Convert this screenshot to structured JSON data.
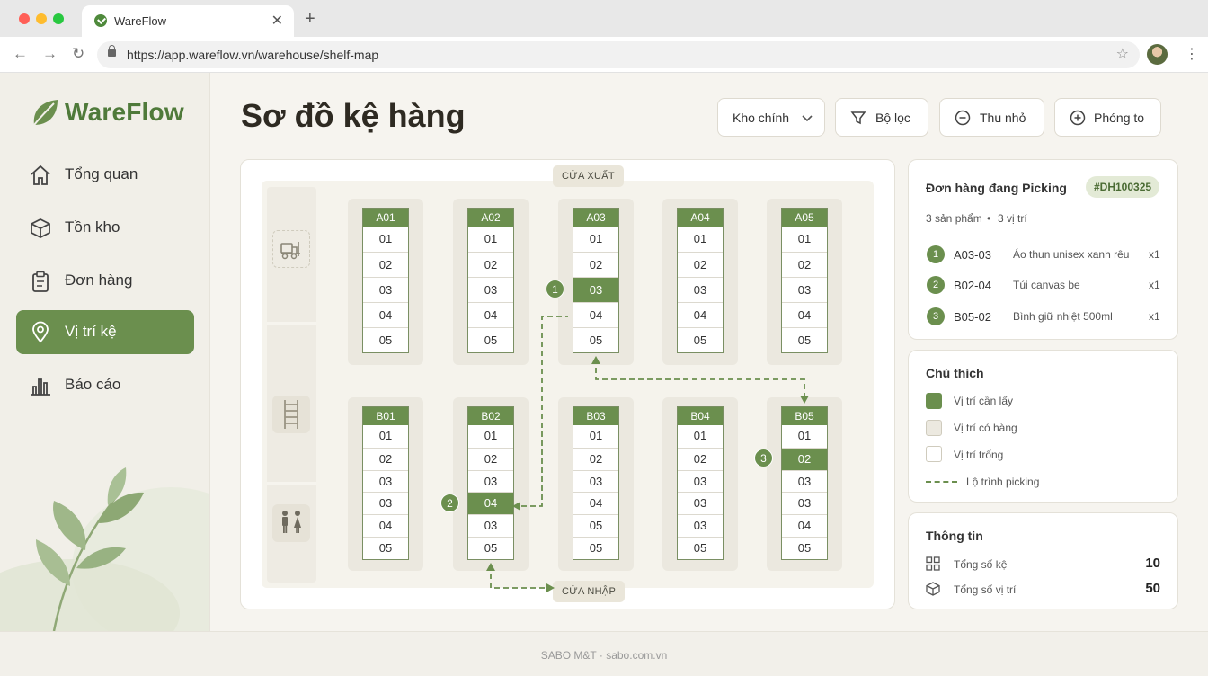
{
  "browser": {
    "tab_title": "WareFlow",
    "url": "https://app.wareflow.vn/warehouse/shelf-map",
    "dot_colors": [
      "#ff5f57",
      "#febc2e",
      "#28c840"
    ]
  },
  "brand": {
    "name": "WareFlow",
    "accent": "#6b8f4e"
  },
  "sidebar": {
    "items": [
      {
        "label": "Tổng quan",
        "icon": "home-icon",
        "active": false
      },
      {
        "label": "Tồn kho",
        "icon": "box-icon",
        "active": false
      },
      {
        "label": "Đơn hàng",
        "icon": "clipboard-icon",
        "active": false
      },
      {
        "label": "Vị trí kệ",
        "icon": "map-pin-icon",
        "active": true
      },
      {
        "label": "Báo cáo",
        "icon": "bar-chart-icon",
        "active": false
      }
    ]
  },
  "page": {
    "title": "Sơ đồ kệ hàng"
  },
  "toolbar": {
    "warehouse_select": "Kho chính",
    "filter": "Bộ lọc",
    "zoom_out": "Thu nhỏ",
    "zoom_in": "Phóng to"
  },
  "map": {
    "exit_door": "CỬA XUẤT",
    "entry_door": "CỬA NHẬP",
    "side_icons": [
      "forklift-icon",
      "ladder-icon",
      "restroom-icon"
    ],
    "row_a": [
      {
        "name": "A01",
        "cells": [
          "01",
          "02",
          "03",
          "04",
          "05"
        ],
        "highlight": -1
      },
      {
        "name": "A02",
        "cells": [
          "01",
          "02",
          "03",
          "04",
          "05"
        ],
        "highlight": -1
      },
      {
        "name": "A03",
        "cells": [
          "01",
          "02",
          "03",
          "04",
          "05"
        ],
        "highlight": 2,
        "pick": "1"
      },
      {
        "name": "A04",
        "cells": [
          "01",
          "02",
          "03",
          "04",
          "05"
        ],
        "highlight": -1
      },
      {
        "name": "A05",
        "cells": [
          "01",
          "02",
          "03",
          "04",
          "05"
        ],
        "highlight": -1
      }
    ],
    "row_b": [
      {
        "name": "B01",
        "cells": [
          "01",
          "02",
          "03",
          "03",
          "04",
          "05"
        ],
        "highlight": -1
      },
      {
        "name": "B02",
        "cells": [
          "01",
          "02",
          "03",
          "04",
          "03",
          "05"
        ],
        "highlight": 3,
        "pick": "2"
      },
      {
        "name": "B03",
        "cells": [
          "01",
          "02",
          "03",
          "04",
          "05",
          "05"
        ],
        "highlight": -1
      },
      {
        "name": "B04",
        "cells": [
          "01",
          "02",
          "03",
          "03",
          "03",
          "05"
        ],
        "highlight": -1
      },
      {
        "name": "B05",
        "cells": [
          "01",
          "02",
          "03",
          "03",
          "04",
          "05"
        ],
        "highlight": 1,
        "pick": "3"
      }
    ]
  },
  "order": {
    "title": "Đơn hàng đang Picking",
    "id": "#DH100325",
    "summary_products": "3 sản phẩm",
    "summary_separator": "•",
    "summary_positions": "3 vị trí",
    "items": [
      {
        "num": "1",
        "loc": "A03-03",
        "name": "Áo thun unisex xanh rêu",
        "qty": "x1"
      },
      {
        "num": "2",
        "loc": "B02-04",
        "name": "Túi canvas be",
        "qty": "x1"
      },
      {
        "num": "3",
        "loc": "B05-02",
        "name": "Bình giữ nhiệt 500ml",
        "qty": "x1"
      }
    ]
  },
  "legend": {
    "title": "Chú thích",
    "items": [
      {
        "label": "Vị trí cần lấy",
        "color": "#6b8f4e"
      },
      {
        "label": "Vị trí có hàng",
        "color": "#ece9e0"
      },
      {
        "label": "Vị trí trống",
        "color": "#ffffff"
      },
      {
        "label": "Lộ trình picking",
        "color": "#6b8f4e"
      }
    ]
  },
  "info": {
    "title": "Thông tin",
    "total_shelves_label": "Tổng số kệ",
    "total_shelves": "10",
    "total_positions_label": "Tổng số vị trí",
    "total_positions": "50"
  },
  "footer": {
    "text": "SABO M&T · sabo.com.vn"
  }
}
